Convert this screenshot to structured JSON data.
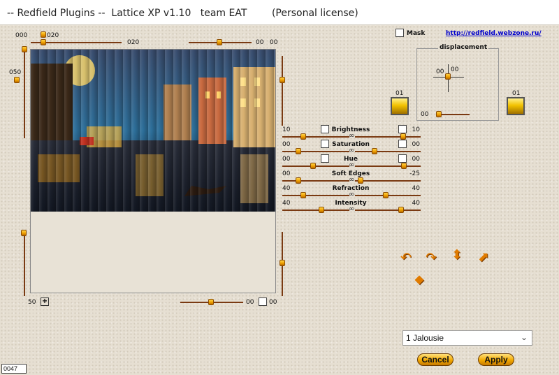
{
  "title": "-- Redfield Plugins --  Lattice XP v1.10   team EAT        (Personal license)",
  "top": {
    "left_val_a": "000",
    "left_val_b": "020",
    "right_slider_label": "020",
    "right_vals": [
      "00",
      "00"
    ],
    "mask_label": "Mask",
    "link": "http://redfield.webzone.ru/"
  },
  "vertical_left_value": "050",
  "displacement": {
    "title": "displacement",
    "x": "00",
    "y": "00",
    "bottom": "00"
  },
  "color_left": {
    "label": "01",
    "color": "#f0c000"
  },
  "color_right": {
    "label": "01",
    "color": "#f0c000"
  },
  "params": [
    {
      "name": "Brightness",
      "left": "10",
      "right": "10",
      "has_checks": true
    },
    {
      "name": "Saturation",
      "left": "00",
      "right": "00",
      "has_checks": true
    },
    {
      "name": "Hue",
      "left": "00",
      "right": "00",
      "has_checks": true
    },
    {
      "name": "Soft Edges",
      "left": "00",
      "right": "-25",
      "has_checks": false
    },
    {
      "name": "Refraction",
      "left": "40",
      "right": "40",
      "has_checks": false
    },
    {
      "name": "Intensity",
      "left": "40",
      "right": "40",
      "has_checks": false
    }
  ],
  "bottom": {
    "zoom": "50",
    "slider_value": "00",
    "check_value": "00"
  },
  "preset": {
    "selected": "1 Jalousie"
  },
  "buttons": {
    "cancel": "Cancel",
    "apply": "Apply"
  },
  "status": "0047",
  "icons": {
    "rotate_left": "rotate-left-icon",
    "rotate_right": "rotate-right-icon",
    "flip_vertical": "flip-vertical-icon",
    "diagonal": "diagonal-arrow-icon",
    "random": "dice-icon"
  }
}
